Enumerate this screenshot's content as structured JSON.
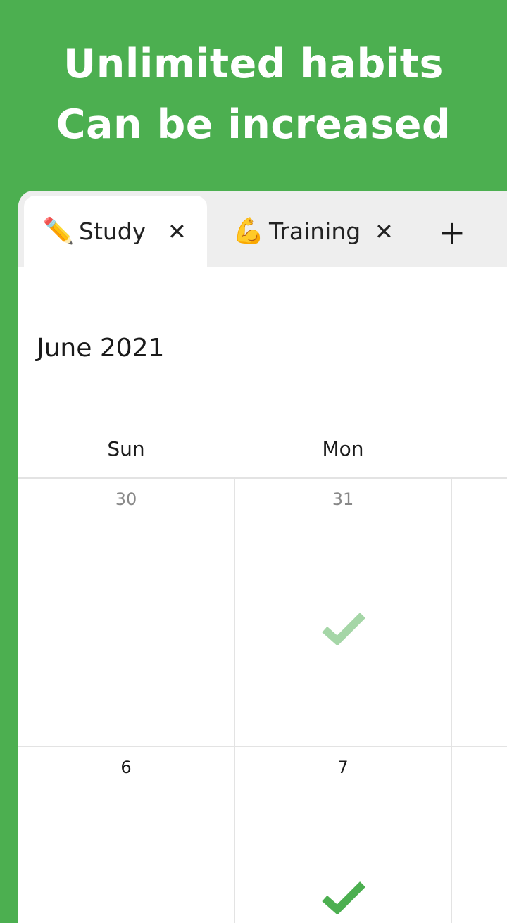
{
  "headline": {
    "line1": "Unlimited habits",
    "line2": "Can be increased"
  },
  "tabs": [
    {
      "icon": "✏️",
      "icon_name": "pencil-icon",
      "label": "Study",
      "close": "✕",
      "active": true
    },
    {
      "icon": "💪",
      "icon_name": "flexed-biceps-icon",
      "label": "Training",
      "close": "✕",
      "active": false
    }
  ],
  "add_tab_label": "+",
  "calendar": {
    "month_title": "June 2021",
    "weekdays": [
      "Sun",
      "Mon"
    ],
    "weeks": [
      [
        {
          "day": "30",
          "checked": false
        },
        {
          "day": "31",
          "checked": true,
          "check_style": "faded"
        }
      ],
      [
        {
          "day": "6",
          "checked": false
        },
        {
          "day": "7",
          "checked": true,
          "check_style": "solid"
        }
      ]
    ]
  },
  "colors": {
    "background_green": "#4caf50",
    "check_faded": "#a5d6a7",
    "check_solid": "#4caf50"
  }
}
